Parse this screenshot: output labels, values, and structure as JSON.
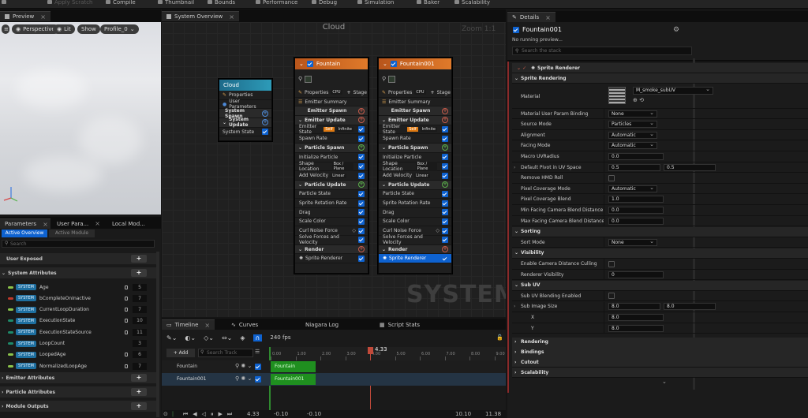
{
  "toolbar": {
    "items": [
      "Apply Scratch",
      "Compile",
      "Thumbnail",
      "Bounds",
      "Performance",
      "Debug",
      "Simulation",
      "Baker",
      "Scalability"
    ]
  },
  "preview": {
    "tab_label": "Preview",
    "buttons": [
      "Perspective",
      "Lit",
      "Show",
      "Profile_0"
    ]
  },
  "graph": {
    "tab_label": "System Overview",
    "title": "Cloud",
    "zoom": "Zoom 1:1",
    "watermark": "SYSTEM",
    "system_node": {
      "title": "Cloud",
      "rows": [
        "Properties",
        "User Parameters",
        "System Spawn",
        "System Update",
        "System State"
      ]
    },
    "emitters": [
      {
        "title": "Fountain",
        "properties": "Properties",
        "cpu": "CPU",
        "stage": "Stage",
        "summary": "Emitter Summary",
        "rows": [
          {
            "t": "sec",
            "label": "Emitter Spawn",
            "btn": "r"
          },
          {
            "t": "sec",
            "label": "Emitter Update",
            "btn": "r"
          },
          {
            "t": "item",
            "label": "Emitter State",
            "tag1": "Self",
            "tag2": "Infinite"
          },
          {
            "t": "item",
            "label": "Spawn Rate"
          },
          {
            "t": "sec",
            "label": "Particle Spawn",
            "btn": "g"
          },
          {
            "t": "item",
            "label": "Initialize Particle"
          },
          {
            "t": "item",
            "label": "Shape Location",
            "tag2": "Box / Plane"
          },
          {
            "t": "item",
            "label": "Add Velocity",
            "tag2": "Linear"
          },
          {
            "t": "sec",
            "label": "Particle Update",
            "btn": "g"
          },
          {
            "t": "item",
            "label": "Particle State"
          },
          {
            "t": "item",
            "label": "Sprite Rotation Rate"
          },
          {
            "t": "item",
            "label": "Drag"
          },
          {
            "t": "item",
            "label": "Scale Color"
          },
          {
            "t": "item",
            "label": "Curl Noise Force",
            "eye": true
          },
          {
            "t": "item",
            "label": "Solve Forces and Velocity"
          },
          {
            "t": "sec",
            "label": "Render",
            "btn": "r"
          },
          {
            "t": "item",
            "label": "Sprite Renderer",
            "render": true
          }
        ]
      },
      {
        "title": "Fountain001",
        "properties": "Properties",
        "cpu": "CPU",
        "stage": "Stage",
        "summary": "Emitter Summary",
        "rows": [
          {
            "t": "sec",
            "label": "Emitter Spawn",
            "btn": "r"
          },
          {
            "t": "sec",
            "label": "Emitter Update",
            "btn": "r"
          },
          {
            "t": "item",
            "label": "Emitter State",
            "tag1": "Self",
            "tag2": "Infinite"
          },
          {
            "t": "item",
            "label": "Spawn Rate"
          },
          {
            "t": "sec",
            "label": "Particle Spawn",
            "btn": "g"
          },
          {
            "t": "item",
            "label": "Initialize Particle"
          },
          {
            "t": "item",
            "label": "Shape Location",
            "tag2": "Box / Plane"
          },
          {
            "t": "item",
            "label": "Add Velocity",
            "tag2": "Linear"
          },
          {
            "t": "sec",
            "label": "Particle Update",
            "btn": "g"
          },
          {
            "t": "item",
            "label": "Particle State"
          },
          {
            "t": "item",
            "label": "Sprite Rotation Rate"
          },
          {
            "t": "item",
            "label": "Drag"
          },
          {
            "t": "item",
            "label": "Scale Color"
          },
          {
            "t": "item",
            "label": "Curl Noise Force",
            "eye": true
          },
          {
            "t": "item",
            "label": "Solve Forces and Velocity"
          },
          {
            "t": "sec",
            "label": "Render",
            "btn": "r"
          },
          {
            "t": "item",
            "label": "Sprite Renderer",
            "render": true,
            "selected": true
          }
        ]
      }
    ]
  },
  "params": {
    "tabs": [
      "Parameters",
      "User Para...",
      "Local Mod..."
    ],
    "subtabs": [
      "Active Overview",
      "Active Module"
    ],
    "search_placeholder": "Search",
    "user_exposed": "User Exposed",
    "system_attributes": "System Attributes",
    "system_tag": "SYSTEM",
    "attributes": [
      {
        "name": "Age",
        "count": "5",
        "lock": true,
        "color": "#8bc34a"
      },
      {
        "name": "bCompleteOnInactive",
        "count": "7",
        "lock": true,
        "color": "#c0392b"
      },
      {
        "name": "CurrentLoopDuration",
        "count": "7",
        "lock": true,
        "color": "#8bc34a"
      },
      {
        "name": "ExecutionState",
        "count": "10",
        "lock": true,
        "color": "#1e8a6a"
      },
      {
        "name": "ExecutionStateSource",
        "count": "11",
        "lock": true,
        "color": "#1e8a6a"
      },
      {
        "name": "LoopCount",
        "count": "3",
        "lock": false,
        "color": "#1e8a6a"
      },
      {
        "name": "LoopedAge",
        "count": "6",
        "lock": true,
        "color": "#8bc34a"
      },
      {
        "name": "NormalizedLoopAge",
        "count": "7",
        "lock": true,
        "color": "#8bc34a"
      }
    ],
    "emitter_attributes": "Emitter Attributes",
    "particle_attributes": "Particle Attributes",
    "module_outputs": "Module Outputs"
  },
  "timeline": {
    "tabs": [
      "Timeline",
      "Curves",
      "Niagara Log",
      "Script Stats"
    ],
    "fps": "240 fps",
    "add_label": "+ Add",
    "search_placeholder": "Search Track",
    "playhead": "4.33",
    "ticks": [
      "0.00",
      "1.00",
      "2.00",
      "3.00",
      "4.00",
      "5.00",
      "6.00",
      "7.00",
      "8.00",
      "9.00",
      "10.00"
    ],
    "tracks": [
      {
        "name": "Fountain",
        "bar": "Fountain"
      },
      {
        "name": "Fountain001",
        "bar": "Fountain001"
      }
    ],
    "footer": {
      "time": "4.33",
      "start1": "-0.10",
      "start2": "-0.10",
      "end1": "10.10",
      "end2": "11.38"
    }
  },
  "details": {
    "tab_label": "Details",
    "emitter_name": "Fountain001",
    "status": "No running preview...",
    "search_placeholder": "Search the stack",
    "renderer_title": "Sprite Renderer",
    "sections": {
      "sprite_rendering": "Sprite Rendering",
      "sorting": "Sorting",
      "visibility": "Visibility",
      "sub_uv": "Sub UV"
    },
    "material_label": "Material",
    "material_value": "M_smoke_subUV",
    "rows": {
      "binding": {
        "label": "Material User Param Binding",
        "value": "None"
      },
      "source_mode": {
        "label": "Source Mode",
        "value": "Particles"
      },
      "alignment": {
        "label": "Alignment",
        "value": "Automatic"
      },
      "facing_mode": {
        "label": "Facing Mode",
        "value": "Automatic"
      },
      "macro_uv": {
        "label": "Macro UVRadius",
        "value": "0.0"
      },
      "pivot": {
        "label": "Default Pivot in UV Space",
        "x": "0.5",
        "y": "0.5"
      },
      "remove_hmd": {
        "label": "Remove HMD Roll"
      },
      "pixel_mode": {
        "label": "Pixel Coverage Mode",
        "value": "Automatic"
      },
      "pixel_blend": {
        "label": "Pixel Coverage Blend",
        "value": "1.0"
      },
      "min_facing": {
        "label": "Min Facing Camera Blend Distance",
        "value": "0.0"
      },
      "max_facing": {
        "label": "Max Facing Camera Blend Distance",
        "value": "0.0"
      },
      "sort_mode": {
        "label": "Sort Mode",
        "value": "None"
      },
      "cam_culling": {
        "label": "Enable Camera Distance Culling"
      },
      "renderer_vis": {
        "label": "Renderer Visibility",
        "value": "0"
      },
      "subuv_blend": {
        "label": "Sub UV Blending Enabled"
      },
      "sub_size": {
        "label": "Sub Image Size",
        "x": "8.0",
        "y": "8.0"
      },
      "x": {
        "label": "X",
        "value": "8.0"
      },
      "y": {
        "label": "Y",
        "value": "8.0"
      }
    },
    "collapsed": [
      "Rendering",
      "Bindings",
      "Cutout",
      "Scalability"
    ]
  }
}
